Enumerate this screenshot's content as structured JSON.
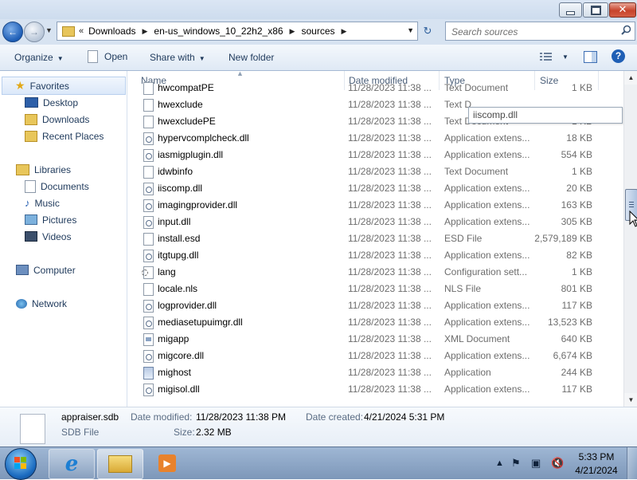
{
  "window": {
    "minimize_icon": "minimize-icon",
    "maximize_icon": "maximize-icon",
    "close_icon": "close-icon"
  },
  "address": {
    "overflow_chevron": "«",
    "breadcrumbs": [
      "Downloads",
      "en-us_windows_10_22h2_x86",
      "sources"
    ],
    "search_placeholder": "Search sources"
  },
  "toolbar": {
    "organize": "Organize",
    "open": "Open",
    "share_with": "Share with",
    "new_folder": "New folder"
  },
  "nav": {
    "favorites": "Favorites",
    "desktop": "Desktop",
    "downloads": "Downloads",
    "recent_places": "Recent Places",
    "libraries": "Libraries",
    "documents": "Documents",
    "music": "Music",
    "pictures": "Pictures",
    "videos": "Videos",
    "computer": "Computer",
    "network": "Network"
  },
  "columns": {
    "name": "Name",
    "date_modified": "Date modified",
    "type": "Type",
    "size": "Size"
  },
  "files": [
    {
      "name": "hwcompatPE",
      "date": "11/28/2023 11:38 ...",
      "type": "Text Document",
      "size": "1 KB",
      "icon": "text"
    },
    {
      "name": "hwexclude",
      "date": "11/28/2023 11:38 ...",
      "type": "Text D",
      "size": "",
      "icon": "text"
    },
    {
      "name": "hwexcludePE",
      "date": "11/28/2023 11:38 ...",
      "type": "Text Document",
      "size": "1 KB",
      "icon": "text"
    },
    {
      "name": "hypervcomplcheck.dll",
      "date": "11/28/2023 11:38 ...",
      "type": "Application extens...",
      "size": "18 KB",
      "icon": "dll"
    },
    {
      "name": "iasmigplugin.dll",
      "date": "11/28/2023 11:38 ...",
      "type": "Application extens...",
      "size": "554 KB",
      "icon": "dll"
    },
    {
      "name": "idwbinfo",
      "date": "11/28/2023 11:38 ...",
      "type": "Text Document",
      "size": "1 KB",
      "icon": "text"
    },
    {
      "name": "iiscomp.dll",
      "date": "11/28/2023 11:38 ...",
      "type": "Application extens...",
      "size": "20 KB",
      "icon": "dll"
    },
    {
      "name": "imagingprovider.dll",
      "date": "11/28/2023 11:38 ...",
      "type": "Application extens...",
      "size": "163 KB",
      "icon": "dll"
    },
    {
      "name": "input.dll",
      "date": "11/28/2023 11:38 ...",
      "type": "Application extens...",
      "size": "305 KB",
      "icon": "dll"
    },
    {
      "name": "install.esd",
      "date": "11/28/2023 11:38 ...",
      "type": "ESD File",
      "size": "2,579,189 KB",
      "icon": "text"
    },
    {
      "name": "itgtupg.dll",
      "date": "11/28/2023 11:38 ...",
      "type": "Application extens...",
      "size": "82 KB",
      "icon": "dll"
    },
    {
      "name": "lang",
      "date": "11/28/2023 11:38 ...",
      "type": "Configuration sett...",
      "size": "1 KB",
      "icon": "cfg"
    },
    {
      "name": "locale.nls",
      "date": "11/28/2023 11:38 ...",
      "type": "NLS File",
      "size": "801 KB",
      "icon": "text"
    },
    {
      "name": "logprovider.dll",
      "date": "11/28/2023 11:38 ...",
      "type": "Application extens...",
      "size": "117 KB",
      "icon": "dll"
    },
    {
      "name": "mediasetupuimgr.dll",
      "date": "11/28/2023 11:38 ...",
      "type": "Application extens...",
      "size": "13,523 KB",
      "icon": "dll"
    },
    {
      "name": "migapp",
      "date": "11/28/2023 11:38 ...",
      "type": "XML Document",
      "size": "640 KB",
      "icon": "xml"
    },
    {
      "name": "migcore.dll",
      "date": "11/28/2023 11:38 ...",
      "type": "Application extens...",
      "size": "6,674 KB",
      "icon": "dll"
    },
    {
      "name": "mighost",
      "date": "11/28/2023 11:38 ...",
      "type": "Application",
      "size": "244 KB",
      "icon": "app"
    },
    {
      "name": "migisol.dll",
      "date": "11/28/2023 11:38 ...",
      "type": "Application extens...",
      "size": "117 KB",
      "icon": "dll"
    }
  ],
  "tooltip": "iiscomp.dll",
  "details": {
    "name": "appraiser.sdb",
    "type": "SDB File",
    "date_modified_label": "Date modified:",
    "date_modified": "11/28/2023 11:38 PM",
    "date_created_label": "Date created:",
    "date_created": "4/21/2024 5:31 PM",
    "size_label": "Size:",
    "size": "2.32 MB"
  },
  "taskbar": {
    "time": "5:33 PM",
    "date": "4/21/2024"
  }
}
